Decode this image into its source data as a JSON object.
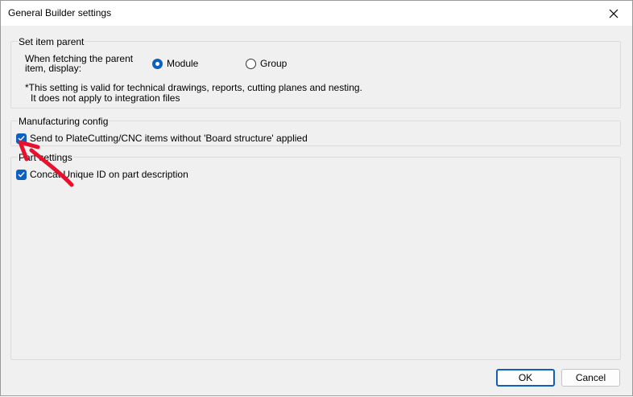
{
  "window": {
    "title": "General Builder settings"
  },
  "groups": {
    "item_parent": {
      "label": "Set item parent",
      "fetch_label": "When fetching the parent item, display:",
      "options": [
        {
          "label": "Module",
          "selected": true
        },
        {
          "label": "Group",
          "selected": false
        }
      ],
      "note_line1": "*This setting is valid for technical drawings, reports, cutting planes and nesting.",
      "note_line2": "It does not apply to integration files"
    },
    "manufacturing": {
      "label": "Manufacturing config",
      "checkbox_label": "Send to PlateCutting/CNC items without 'Board structure' applied",
      "checked": true
    },
    "part_settings": {
      "label": "Part settings",
      "checkbox_label": "Concat Unique ID on part description",
      "checked": true
    }
  },
  "buttons": {
    "ok": "OK",
    "cancel": "Cancel"
  },
  "colors": {
    "accent": "#0f5fbf",
    "annotation": "#e8112d"
  }
}
